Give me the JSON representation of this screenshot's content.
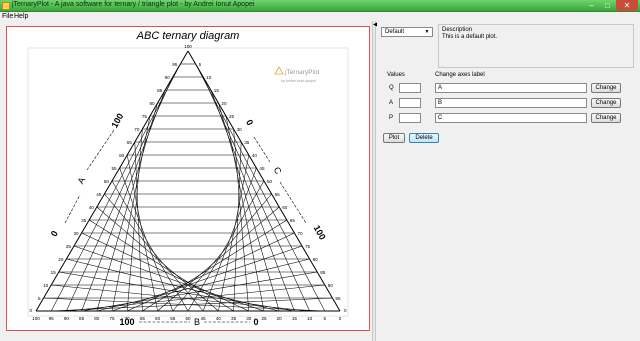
{
  "window": {
    "title": "jTernaryPlot - A java software for ternary / triangle plot - by Andrei Ionut Apopei"
  },
  "menu": {
    "file": "File",
    "help": "Help"
  },
  "plot": {
    "title": "ABC ternary diagram",
    "watermark_name": "jTernaryPlot",
    "watermark_by": "by Andrei Ionut Apopei",
    "axis_a": {
      "label": "A",
      "start": "0",
      "end": "100"
    },
    "axis_b": {
      "label": "B",
      "start": "100",
      "end": "0"
    },
    "axis_c": {
      "label": "C",
      "start": "0",
      "end": "100"
    },
    "ticks": [
      "5",
      "10",
      "15",
      "20",
      "25",
      "30",
      "35",
      "40",
      "45",
      "50",
      "55",
      "60",
      "65",
      "70",
      "75",
      "80",
      "85",
      "90",
      "95",
      "100"
    ],
    "bottom_ticks": [
      "100",
      "95",
      "90",
      "85",
      "80",
      "75",
      "70",
      "65",
      "60",
      "55",
      "50",
      "45",
      "40",
      "35",
      "30",
      "25",
      "20",
      "15",
      "10",
      "5",
      "0"
    ],
    "top_apex": "100",
    "left_corner": "0",
    "right_corner": "0"
  },
  "controls": {
    "preset": "Default",
    "description_title": "Description",
    "description_text": "This is a default plot.",
    "values_label": "Values",
    "change_axes_label": "Change axes label",
    "rows": [
      {
        "key": "Q",
        "value": "",
        "axis_label": "A",
        "button": "Change"
      },
      {
        "key": "A",
        "value": "",
        "axis_label": "B",
        "button": "Change"
      },
      {
        "key": "P",
        "value": "",
        "axis_label": "C",
        "button": "Change"
      }
    ],
    "plot_button": "Plot",
    "delete_button": "Delete"
  }
}
